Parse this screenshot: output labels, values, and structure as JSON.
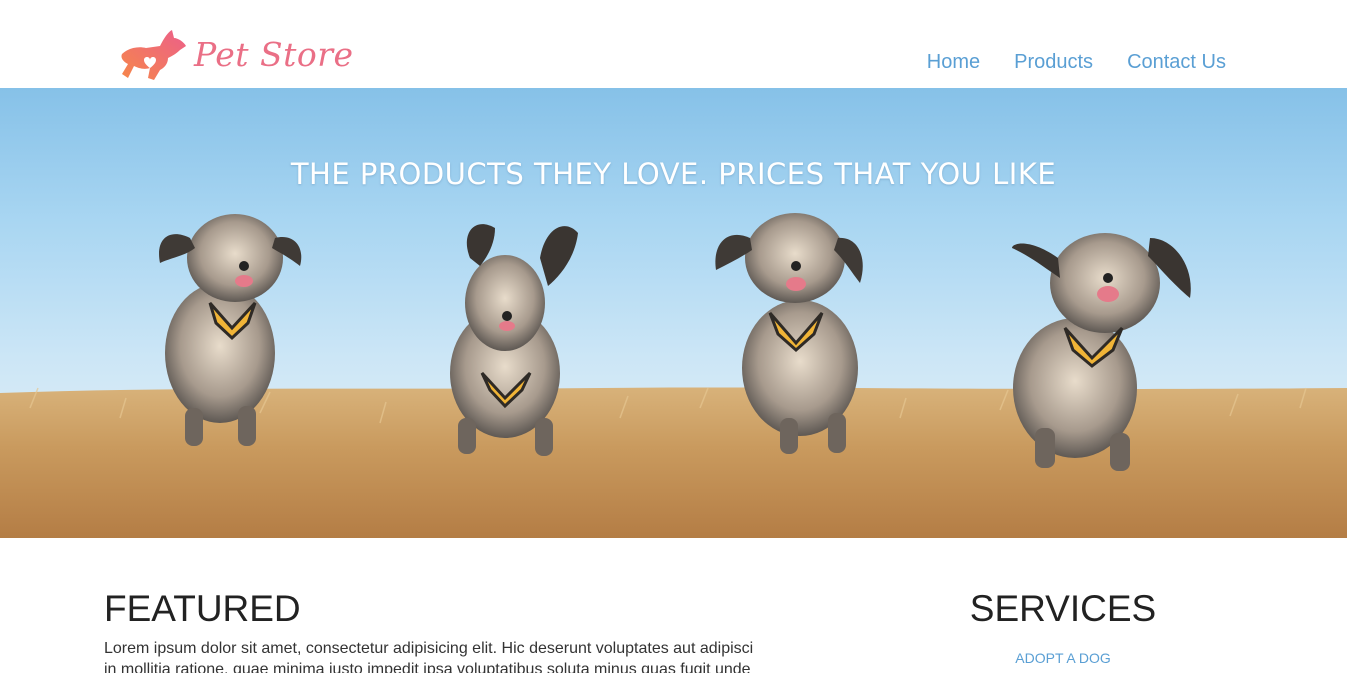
{
  "header": {
    "logo_text": "Pet Store",
    "nav": [
      {
        "label": "Home"
      },
      {
        "label": "Products"
      },
      {
        "label": "Contact Us"
      }
    ]
  },
  "hero": {
    "headline": "THE PRODUCTS THEY LOVE. PRICES THAT YOU LIKE"
  },
  "featured": {
    "title": "FEATURED",
    "text": "Lorem ipsum dolor sit amet, consectetur adipisicing elit. Hic deserunt voluptates aut adipisci in mollitia ratione, quae minima iusto impedit ipsa voluptatibus soluta minus quas fugit unde"
  },
  "services": {
    "title": "SERVICES",
    "link_adopt": "ADOPT A DOG"
  },
  "colors": {
    "brand": "#ea6f86",
    "link": "#5a9fd4"
  }
}
